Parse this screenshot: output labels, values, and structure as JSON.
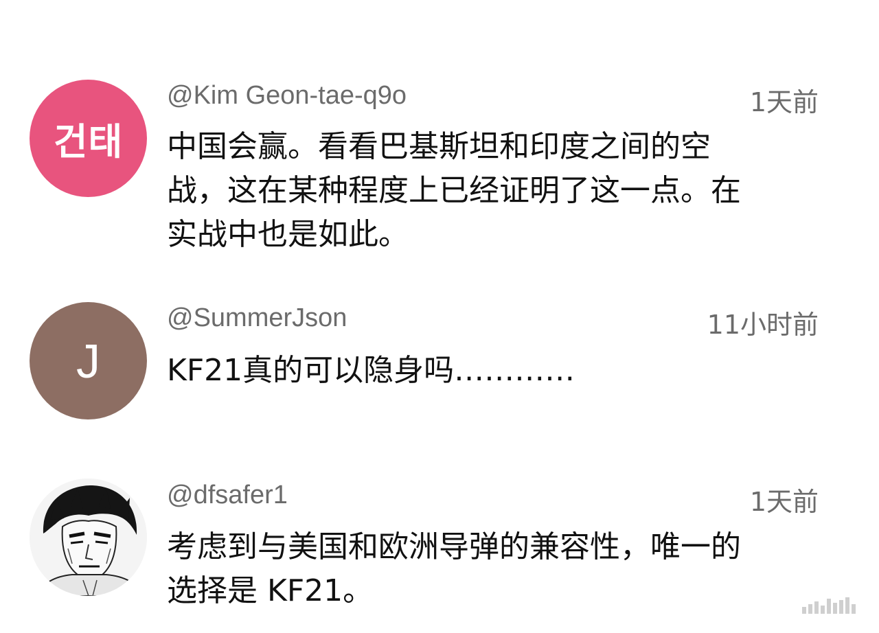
{
  "comments": [
    {
      "handle": "@Kim Geon-tae-q9o",
      "time": "1天前",
      "avatar_text": "건태",
      "avatar_color": "#e8547e",
      "lines": [
        "中国会赢。看看巴基斯坦和印度之间的空",
        "战，这在某种程度上已经证明了这一点。在",
        "实战中也是如此。"
      ]
    },
    {
      "handle": "@SummerJson",
      "time": "11小时前",
      "avatar_text": "J",
      "avatar_color": "#8d6e63",
      "lines": [
        "KF21真的可以隐身吗…………"
      ]
    },
    {
      "handle": "@dfsafer1",
      "time": "1天前",
      "avatar_icon": "manga-face-avatar-icon",
      "lines": [
        "考虑到与美国和欧洲导弹的兼容性，唯一的",
        "选择是 KF21。"
      ]
    }
  ]
}
